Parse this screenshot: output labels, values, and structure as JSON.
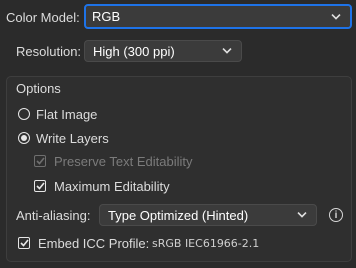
{
  "color_model": {
    "label": "Color Model:",
    "value": "RGB"
  },
  "resolution": {
    "label": "Resolution:",
    "value": "High (300 ppi)"
  },
  "options": {
    "heading": "Options",
    "flat_image": {
      "label": "Flat Image",
      "selected": false
    },
    "write_layers": {
      "label": "Write Layers",
      "selected": true
    },
    "preserve_text": {
      "label": "Preserve Text Editability",
      "checked": true,
      "enabled": false
    },
    "max_editability": {
      "label": "Maximum Editability",
      "checked": true,
      "enabled": true
    },
    "anti_aliasing": {
      "label": "Anti-aliasing:",
      "value": "Type Optimized (Hinted)"
    },
    "embed_icc": {
      "label": "Embed ICC Profile:",
      "checked": true,
      "profile": "sRGB IEC61966-2.1"
    }
  },
  "icons": {
    "chevron": "chevron-down-icon",
    "info": "info-icon",
    "check": "checkmark-icon"
  },
  "colors": {
    "focus_ring": "#1e73e8",
    "background": "#2b2b2b",
    "control": "#3b3b3b"
  }
}
